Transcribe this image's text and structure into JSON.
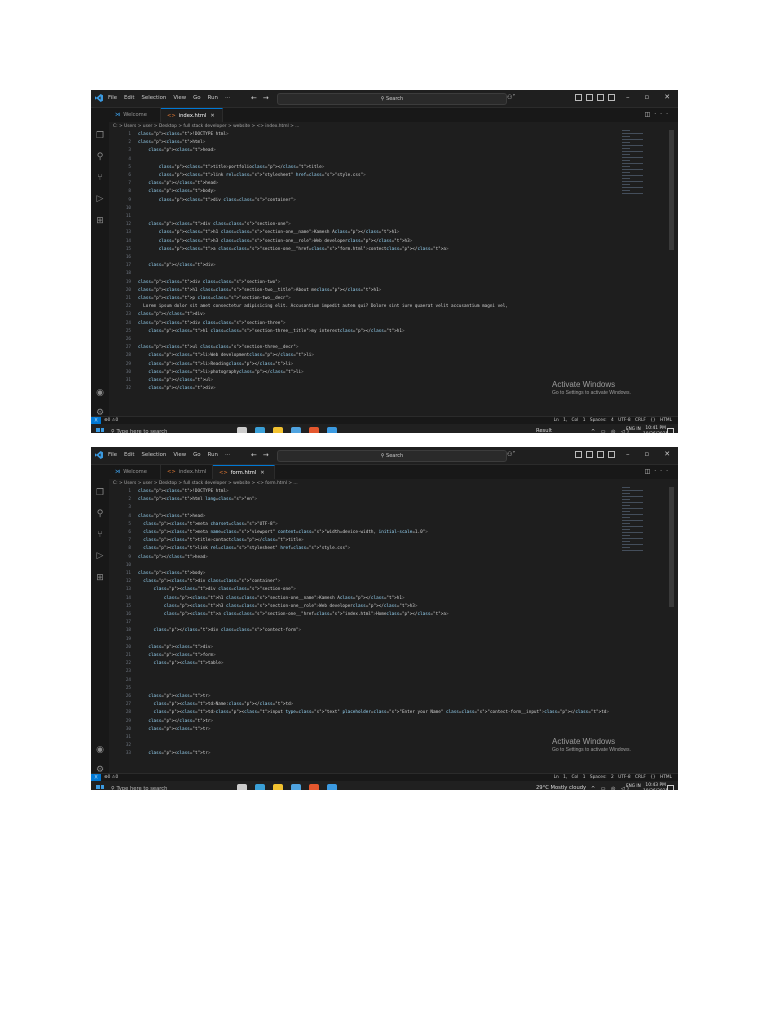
{
  "screenshots": [
    {
      "menu": [
        "File",
        "Edit",
        "Selection",
        "View",
        "Go",
        "Run",
        "···"
      ],
      "search": "Search",
      "tabs": [
        {
          "label": "Welcome",
          "kind": "vscode",
          "active": false
        },
        {
          "label": "index.html",
          "kind": "html",
          "active": true
        }
      ],
      "breadcrumb": "C: > Users > user > Desktop > full stack developer > website > <> index.html > ...",
      "code_lines": [
        "<!DOCTYPE html>",
        "<html>",
        "    <head>",
        "",
        "        <title>portfolio</title>",
        "        <link rel=\"stylesheet\" href=\"style.css\">",
        "    </head>",
        "    <body>",
        "        <div class=\"container\">",
        "",
        "",
        "    <div class=\"section-one\">",
        "        <h1 class=\"section-one__name\">Kamesh A</h1>",
        "        <h3 class=\"section-one__role\">Web developer</h3>",
        "        <a class=\"section-one__\"href=\"form.html\">contect</a>",
        "",
        "    </div>",
        "",
        "<div class=\"section-two\">",
        "<h1 class=\"section-two__title\">About me</h1>",
        "<p class=\"section-two__decr\">",
        "  Lorem ipsum dolor sit amet consectetur adipisicing elit. Accusantium impedit autem qui? Dolore sint iure quaerat velit accusantium magni vel,",
        "</div>",
        "<div class=\"section-three\">",
        "    <h1 class=\"section-three__title\">my interest</h1>",
        "",
        "<ul class=\"section-three__decr\">",
        "    <li>Web development</li>",
        "    <li>Reading</li>",
        "    <li>photography</li>",
        "    </ul>",
        "    </div>"
      ],
      "activate_title": "Activate Windows",
      "activate_sub": "Go to Settings to activate Windows.",
      "status_left": "⊗0 ⚠0",
      "status_right": "Ln 1, Col 1   Spaces: 4   UTF-8   CRLF   {} HTML",
      "taskbar_search": "Type here to search",
      "taskbar_weather": "Result",
      "lang": "ENG IN",
      "time": "10:41 PM",
      "date": "10/26/2025"
    },
    {
      "menu": [
        "File",
        "Edit",
        "Selection",
        "View",
        "Go",
        "Run",
        "···"
      ],
      "search": "Search",
      "tabs": [
        {
          "label": "Welcome",
          "kind": "vscode",
          "active": false
        },
        {
          "label": "index.html",
          "kind": "html",
          "active": false
        },
        {
          "label": "form.html",
          "kind": "html",
          "active": true
        }
      ],
      "breadcrumb": "C: > Users > user > Desktop > full stack developer > website > <> form.html > ...",
      "code_lines": [
        "<!DOCTYPE html>",
        "<html lang=\"en\">",
        "",
        "<head>",
        "  <meta charset=\"UTF-8\">",
        "  <meta name=\"viewport\" content=\"width=device-width, initial-scale=1.0\">",
        "  <title>contact</title>",
        "  <link rel=\"stylesheet\" href=\"style.css\">",
        "</head>",
        "",
        "<body>",
        "  <div class=\"container\">",
        "      <div class=\"section-one\">",
        "          <h1 class=\"section-one__name\">Kamesh A</h1>",
        "          <h3 class=\"section-one__role\">Web developer</h3>",
        "          <a class=\"section-one__\"href=\"index.html\">Home</a>",
        "",
        "      </div class=\"contect-form\">",
        "",
        "    <div>",
        "    <form>",
        "      <table>",
        "",
        "",
        "",
        "    <tr>",
        "      <td>Name:</td>",
        "      <td><input type=\"text\" placeholder=\"Enter your Name\" class=\"contect-form__input\"></td>",
        "    </tr>",
        "    <tr>",
        "",
        "",
        "    <tr>"
      ],
      "activate_title": "Activate Windows",
      "activate_sub": "Go to Settings to activate Windows.",
      "status_left": "⊗0 ⚠0",
      "status_right": "Ln 1, Col 1   Spaces: 2   UTF-8   CRLF   {} HTML",
      "taskbar_search": "Type here to search",
      "taskbar_weather": "29°C  Mostly cloudy",
      "lang": "ENG IN",
      "time": "10:43 PM",
      "date": "10/26/2025"
    }
  ],
  "colors": {
    "editor_bg": "#1e1e1e",
    "accent": "#0078d4",
    "tag": "#569cd6",
    "attr": "#9cdcfe",
    "string": "#ce9178"
  }
}
